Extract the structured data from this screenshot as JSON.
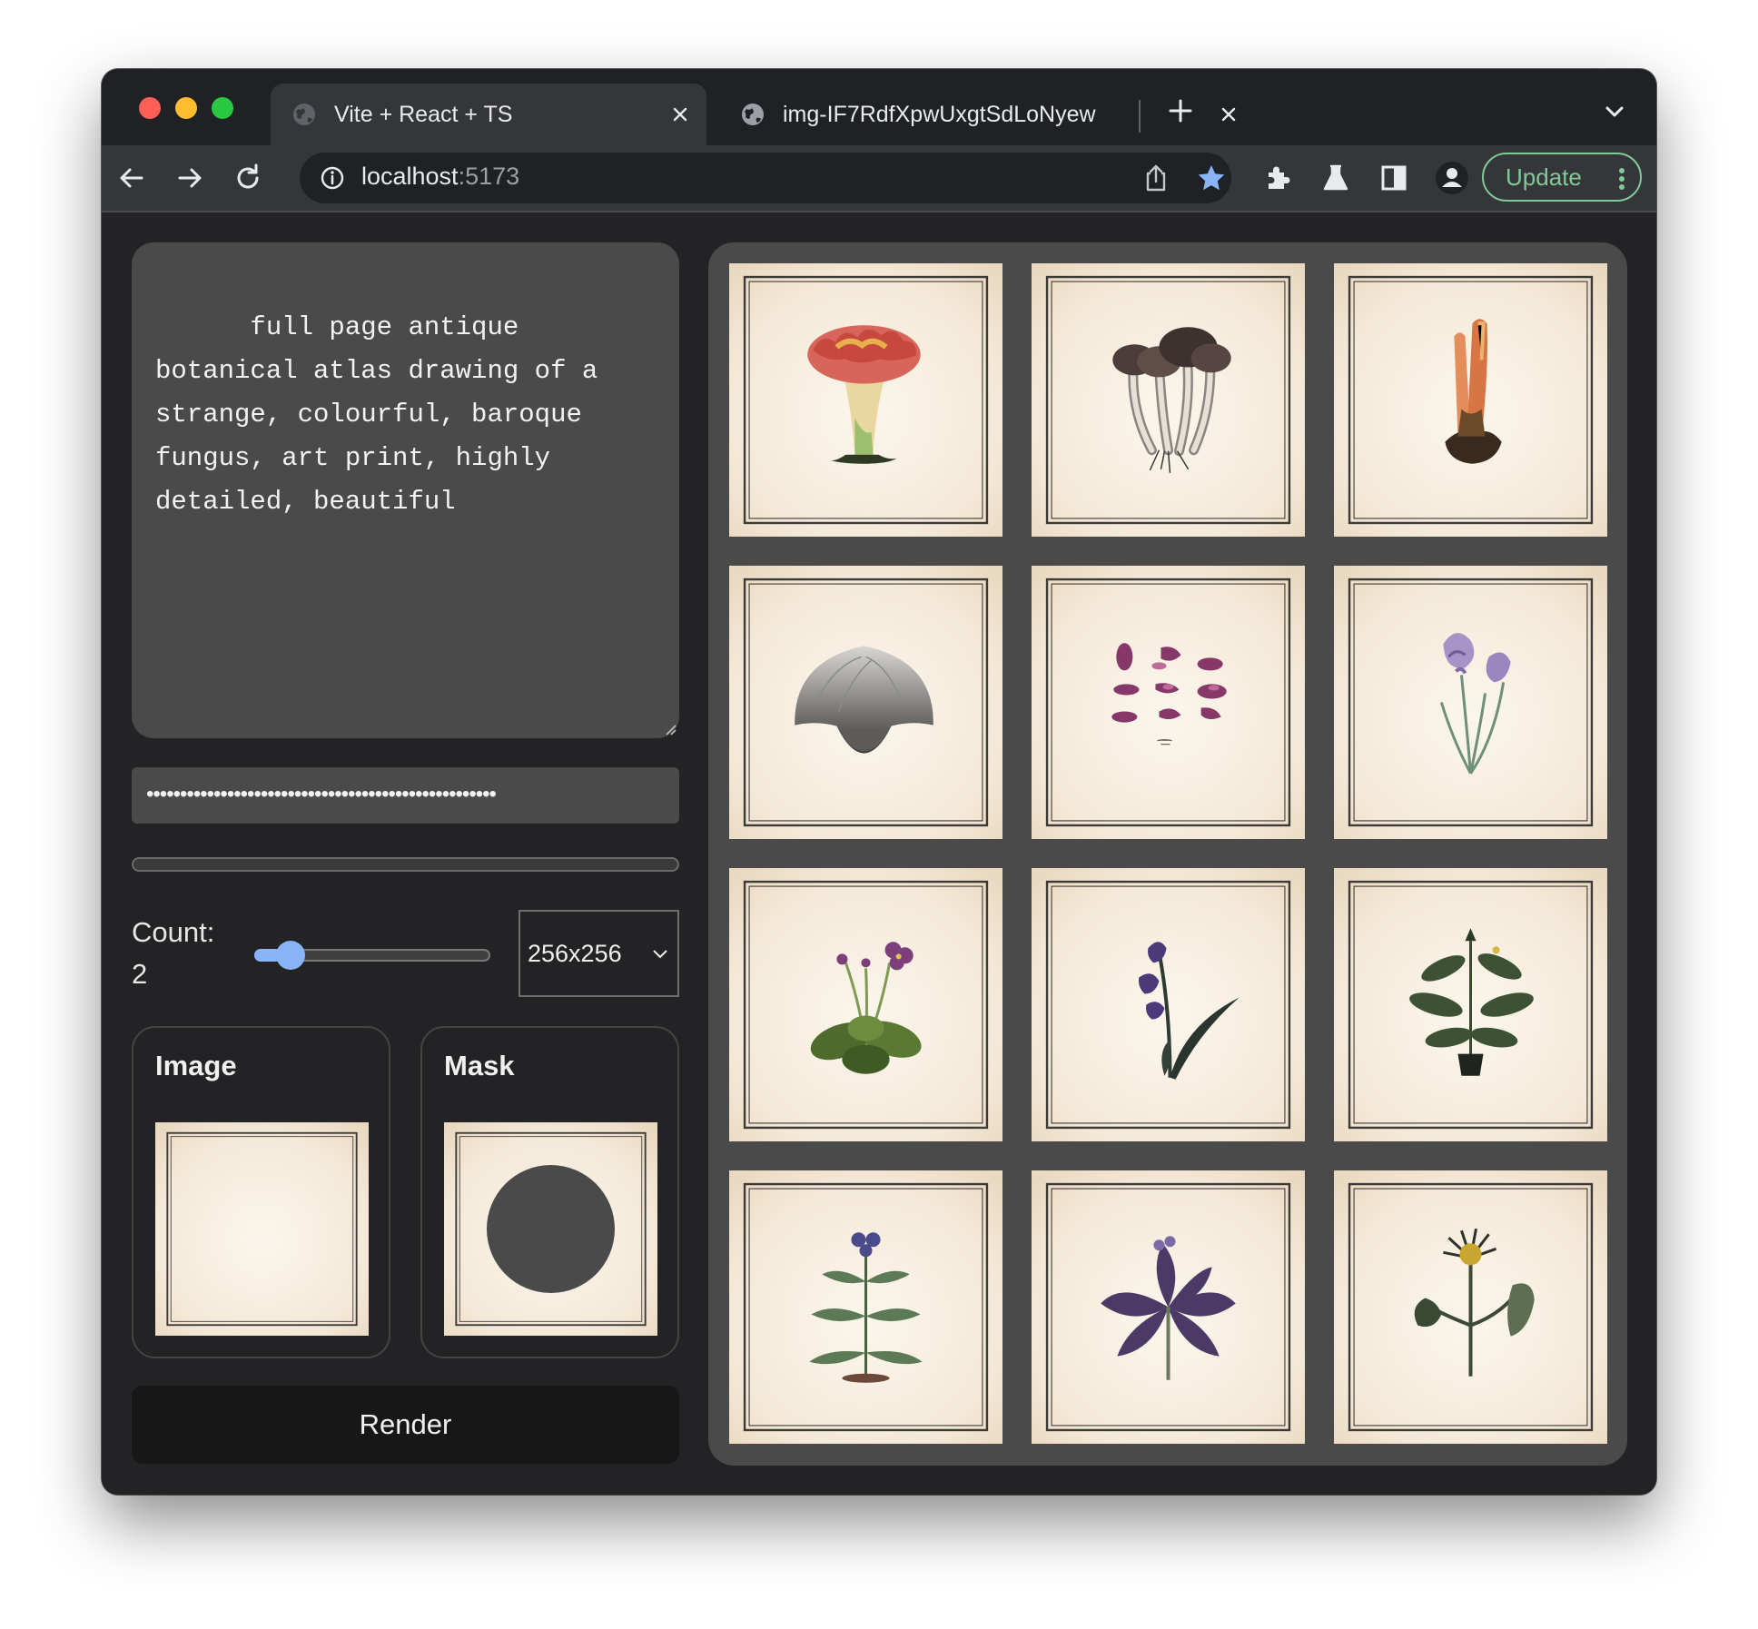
{
  "browser": {
    "tabs": [
      {
        "title": "Vite + React + TS",
        "active": true
      },
      {
        "title": "img-IF7RdfXpwUxgtSdLoNyew",
        "active": false
      }
    ],
    "address": {
      "host": "localhost",
      "port": ":5173"
    },
    "update_label": "Update",
    "icons": [
      "back-arrow-icon",
      "forward-arrow-icon",
      "reload-icon",
      "info-icon",
      "share-icon",
      "bookmark-star-icon",
      "extensions-puzzle-icon",
      "labs-flask-icon",
      "side-panel-icon",
      "profile-icon",
      "menu-dots-icon"
    ]
  },
  "form": {
    "prompt": "full page antique botanical atlas drawing of a strange, colourful, baroque fungus, art print, highly detailed, beautiful",
    "api_key_masked": "••••••••••••••••••••••••••••••••••••••••••••••••••••",
    "progress": 0,
    "count_label": "Count:",
    "count_value": "2",
    "count": 2,
    "count_min": 1,
    "count_max": 10,
    "size_selected": "256x256",
    "image_label": "Image",
    "mask_label": "Mask",
    "render_label": "Render"
  },
  "gallery": {
    "subjects": [
      "orange-fungus",
      "brown-mushroom-cluster",
      "coral-fungus",
      "grey-bell-mushroom",
      "purple-petals-grid",
      "lilac-iris",
      "violet-primrose",
      "purple-bluebell",
      "potted-green-plant",
      "leafy-blue-flower",
      "purple-leaf-plant",
      "yellow-thistle"
    ]
  },
  "colors": {
    "accent": "#8ab4f8",
    "panel": "#4a4a4b",
    "background": "#232325",
    "paper": "#f3e7d6",
    "update_green": "#81c995"
  }
}
